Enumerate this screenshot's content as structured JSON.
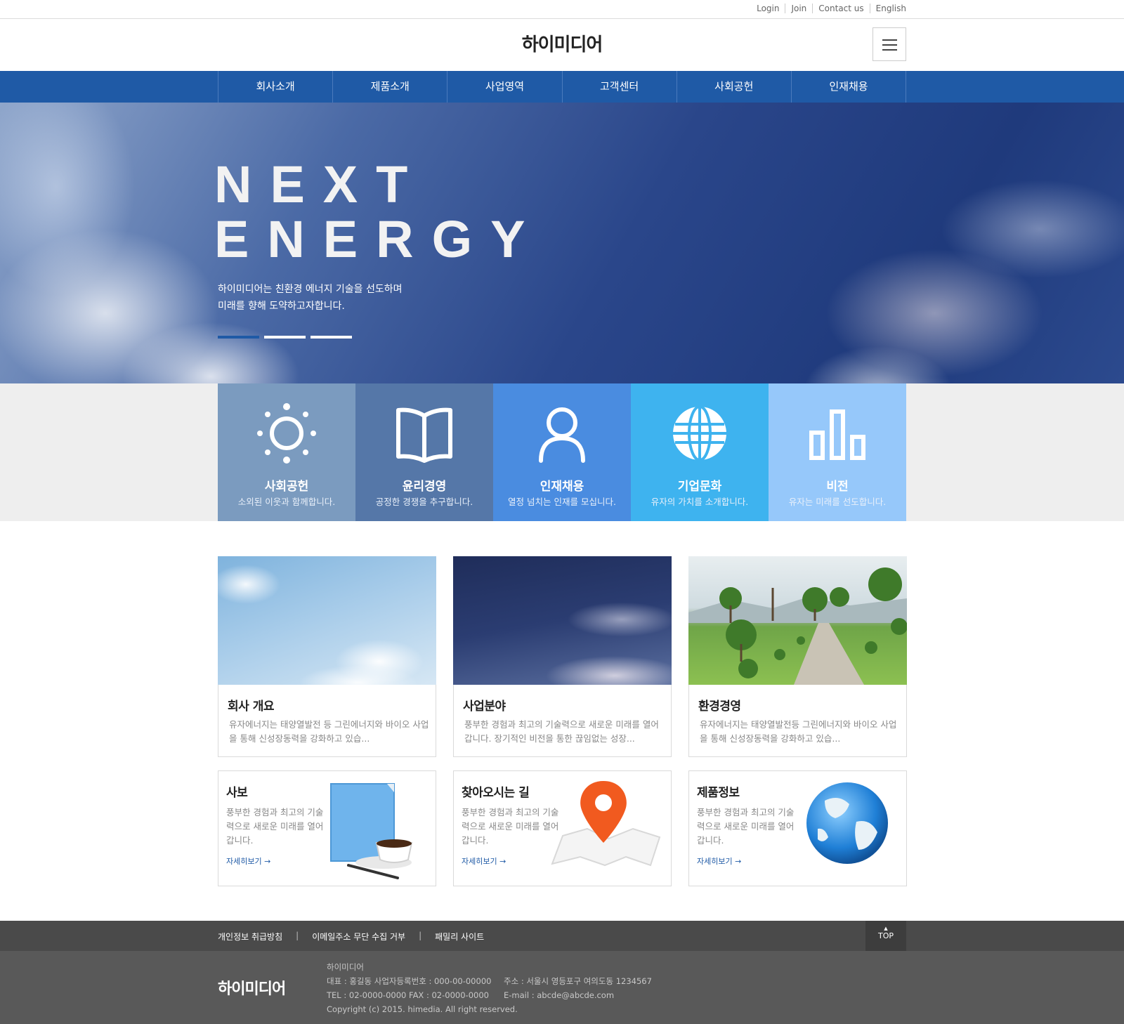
{
  "util_nav": [
    "Login",
    "Join",
    "Contact us",
    "English"
  ],
  "header": {
    "logo": "하이미디어",
    "menu_icon": "hamburger-icon"
  },
  "gnb": [
    "회사소개",
    "제품소개",
    "사업영역",
    "고객센터",
    "사회공헌",
    "인재채용"
  ],
  "hero": {
    "title_line1": "NEXT",
    "title_line2": "ENERGY",
    "desc_line1": "하이미디어는 친환경 에너지 기술을 선도하며",
    "desc_line2": "미래를 향해 도약하고자합니다.",
    "slide_count": 3,
    "active_slide": 1
  },
  "quick": [
    {
      "icon": "sun-icon",
      "title": "사회공헌",
      "desc": "소외된 이웃과 함께합니다.",
      "color": "#7b9bbf"
    },
    {
      "icon": "book-icon",
      "title": "윤리경영",
      "desc": "공정한 경쟁을 추구합니다.",
      "color": "#5577a8"
    },
    {
      "icon": "user-icon",
      "title": "인재채용",
      "desc": "열정 넘치는 인재를 모십니다.",
      "color": "#4a8ce0"
    },
    {
      "icon": "globe-icon",
      "title": "기업문화",
      "desc": "유자의 가치를 소개합니다.",
      "color": "#3eb3ef"
    },
    {
      "icon": "bar-chart-icon",
      "title": "비전",
      "desc": "유자는 미래를 선도합니다.",
      "color": "#96c8fa"
    }
  ],
  "cards": [
    {
      "title": "회사 개요",
      "desc": "유자에너지는 태양열발전 등 그린에너지와 바이오 사업을 통해 신성장동력을 강화하고 있습..."
    },
    {
      "title": "사업분야",
      "desc": "풍부한 경험과 최고의 기술력으로 새로운 미래를 열어갑니다. 장기적인 비전을 통한 끊임없는 성장..."
    },
    {
      "title": "환경경영",
      "desc": "유자에너지는 태양열발전등 그린에너지와 바이오 사업을 통해 신성장동력을 강화하고 있습..."
    }
  ],
  "boxes": [
    {
      "title": "사보",
      "desc": "풍부한 경험과 최고의 기술력으로 새로운 미래를 열어갑니다.",
      "more": "자세히보기 →",
      "icon": "brochure-coffee-icon"
    },
    {
      "title": "찾아오시는 길",
      "desc": "풍부한 경험과 최고의 기술력으로 새로운 미래를 열어갑니다.",
      "more": "자세히보기 →",
      "icon": "map-pin-icon"
    },
    {
      "title": "제품정보",
      "desc": "풍부한 경험과 최고의 기술력으로 새로운 미래를 열어갑니다.",
      "more": "자세히보기 →",
      "icon": "earth-globe-icon"
    }
  ],
  "footer_nav": [
    "개인정보 취급방침",
    "이메일주소 무단 수집 거부",
    "패밀리 사이트"
  ],
  "top_button": "TOP",
  "footer": {
    "logo": "하이미디어",
    "company": "하이미디어",
    "ceo_biz": "대표 : 홍길동     사업자등록번호 : 000-00-00000",
    "address": "주소 : 서울시 영등포구 여의도동 1234567",
    "tel_fax": "TEL : 02-0000-0000     FAX : 02-0000-0000",
    "email": "E-mail : abcde@abcde.com",
    "copyright": "Copyright (c) 2015. himedia. All right reserved."
  },
  "colors": {
    "brand_blue": "#1f5aa6",
    "footer_dark": "#4a4a4a",
    "footer_bg": "#595959"
  }
}
